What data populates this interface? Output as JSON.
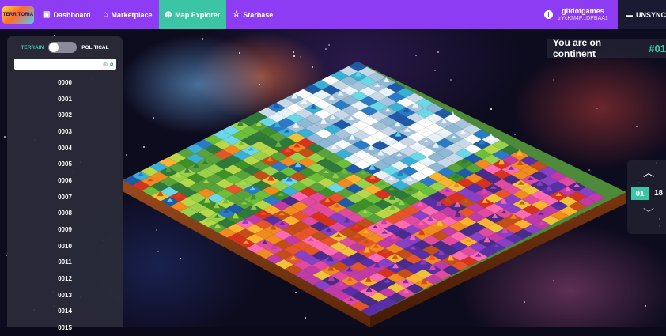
{
  "nav": {
    "logo_text": "TERRITORIA",
    "items": [
      {
        "label": "Dashboard",
        "icon": "dashboard-icon",
        "glyph": "▣"
      },
      {
        "label": "Marketplace",
        "icon": "store-icon",
        "glyph": "⌂"
      },
      {
        "label": "Map Explorer",
        "icon": "globe-icon",
        "glyph": "◍",
        "active": true
      },
      {
        "label": "Starbase",
        "icon": "star-icon",
        "glyph": "☆"
      }
    ],
    "user": {
      "name": "gifdotgames",
      "address": "trYcKM4F...DPBAA1"
    },
    "unsync_label": "UNSYNC"
  },
  "sidebar": {
    "toggle": {
      "left": "TERRAIN",
      "right": "POLITICAL"
    },
    "search": {
      "value": "",
      "placeholder": ""
    },
    "items": [
      "0000",
      "0001",
      "0002",
      "0003",
      "0004",
      "0005",
      "0006",
      "0007",
      "0008",
      "0009",
      "0010",
      "0011",
      "0012",
      "0013",
      "0014",
      "0015"
    ]
  },
  "continent": {
    "prefix": "You are on continent",
    "number": "#01"
  },
  "pager": {
    "current": "01",
    "total": "18"
  },
  "colors": {
    "brand": "#8e3cf3",
    "accent": "#3cc5a5",
    "panel": "#2a2b3a"
  }
}
